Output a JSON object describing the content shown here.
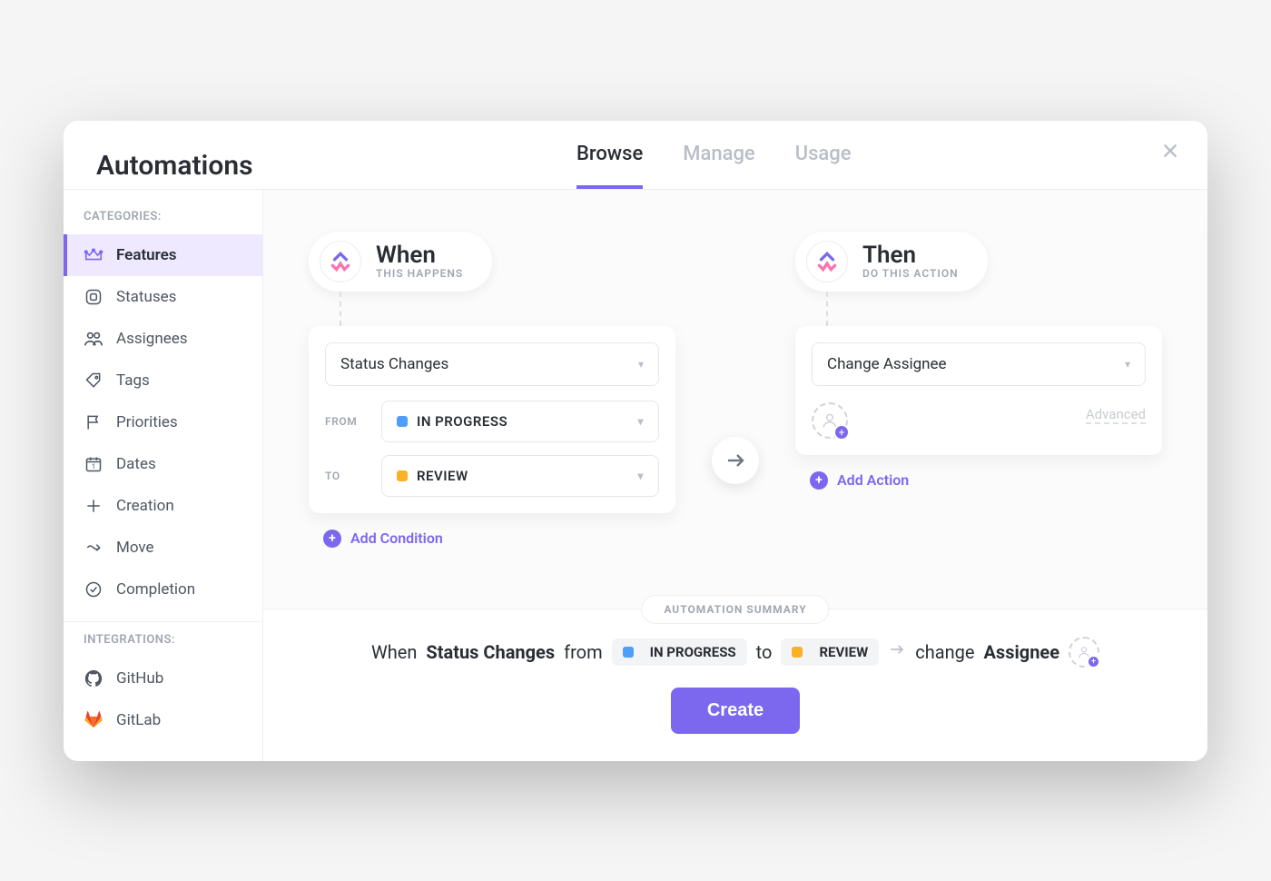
{
  "colors": {
    "accent": "#7b68ee",
    "status_in_progress": "#4f9ef8",
    "status_review": "#f9b125"
  },
  "header": {
    "title": "Automations",
    "tabs": [
      "Browse",
      "Manage",
      "Usage"
    ],
    "active_tab": "Browse"
  },
  "sidebar": {
    "categories_label": "CATEGORIES:",
    "integrations_label": "INTEGRATIONS:",
    "categories": [
      {
        "icon": "crown",
        "label": "Features",
        "active": true
      },
      {
        "icon": "status",
        "label": "Statuses"
      },
      {
        "icon": "assignees",
        "label": "Assignees"
      },
      {
        "icon": "tags",
        "label": "Tags"
      },
      {
        "icon": "priorities",
        "label": "Priorities"
      },
      {
        "icon": "dates",
        "label": "Dates"
      },
      {
        "icon": "creation",
        "label": "Creation"
      },
      {
        "icon": "move",
        "label": "Move"
      },
      {
        "icon": "completion",
        "label": "Completion"
      }
    ],
    "integrations": [
      {
        "icon": "github",
        "label": "GitHub"
      },
      {
        "icon": "gitlab",
        "label": "GitLab"
      }
    ]
  },
  "builder": {
    "when": {
      "title": "When",
      "subtitle": "THIS HAPPENS",
      "trigger_label": "Status Changes",
      "from_label": "FROM",
      "to_label": "TO",
      "from_value": "IN PROGRESS",
      "to_value": "REVIEW",
      "add_condition_label": "Add Condition"
    },
    "then": {
      "title": "Then",
      "subtitle": "DO THIS ACTION",
      "action_label": "Change Assignee",
      "advanced_label": "Advanced",
      "add_action_label": "Add Action"
    }
  },
  "summary": {
    "badge": "AUTOMATION SUMMARY",
    "parts": {
      "when": "When",
      "trigger": "Status Changes",
      "from": "from",
      "from_status": "IN PROGRESS",
      "to": "to",
      "to_status": "REVIEW",
      "change": "change",
      "assignee": "Assignee"
    },
    "create_button": "Create"
  }
}
